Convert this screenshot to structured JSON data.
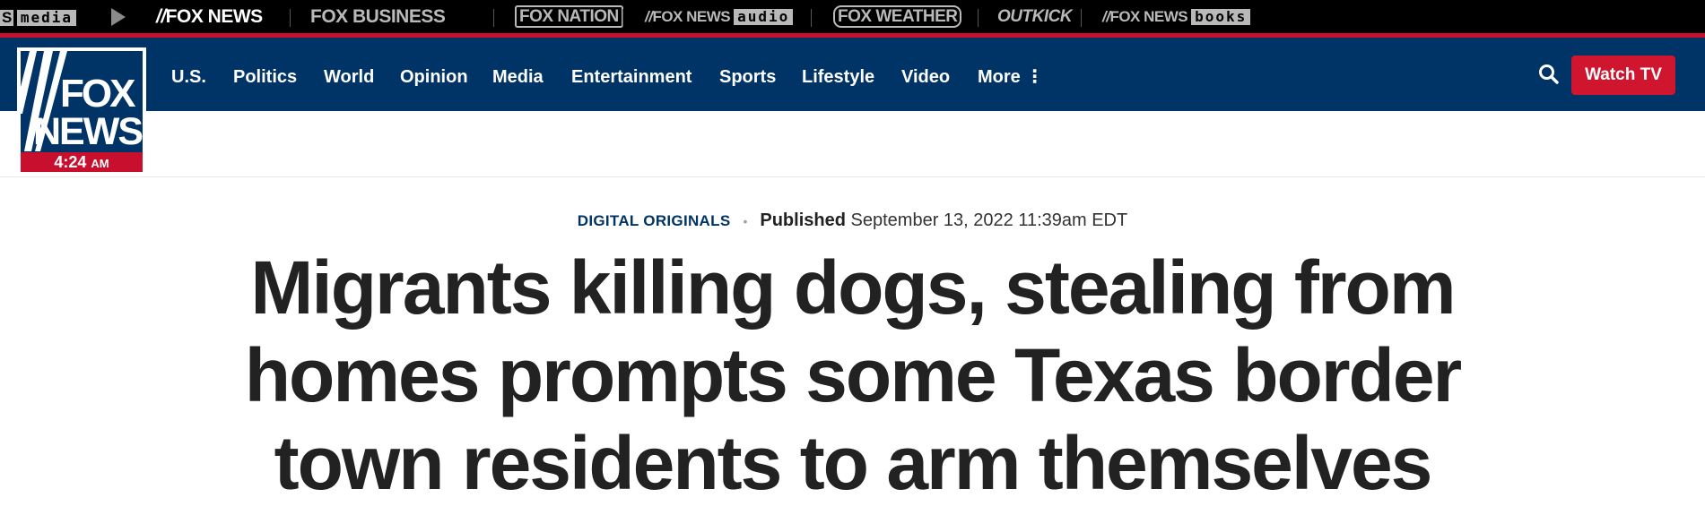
{
  "network_bar": {
    "items": [
      {
        "id": "fox-media",
        "label": "S",
        "boxed": "media"
      },
      {
        "id": "fox-news",
        "label": "FOX NEWS"
      },
      {
        "id": "fox-business",
        "label": "FOX BUSINESS"
      },
      {
        "id": "fox-nation",
        "label": "FOX NATION"
      },
      {
        "id": "fox-news-audio",
        "label": "FOX NEWS",
        "boxed": "audio"
      },
      {
        "id": "fox-weather",
        "label": "FOX WEATHER"
      },
      {
        "id": "outkick",
        "label": "OUTKICK"
      },
      {
        "id": "fox-news-books",
        "label": "FOX NEWS",
        "boxed": "books"
      }
    ]
  },
  "logo": {
    "fox": "FOX",
    "news": "NEWS",
    "time": "4:24",
    "ampm": "AM"
  },
  "nav": {
    "links": [
      "U.S.",
      "Politics",
      "World",
      "Opinion",
      "Media",
      "Entertainment",
      "Sports",
      "Lifestyle",
      "Video",
      "More"
    ],
    "watch_tv": "Watch TV"
  },
  "article": {
    "category": "DIGITAL ORIGINALS",
    "published_label": "Published",
    "published_date": "September 13, 2022 11:39am EDT",
    "headline": "Migrants killing dogs, stealing from homes prompts some Texas border town residents to arm themselves"
  },
  "colors": {
    "nav_blue": "#003366",
    "accent_red": "#c8102e",
    "watch_red": "#d0152e"
  }
}
